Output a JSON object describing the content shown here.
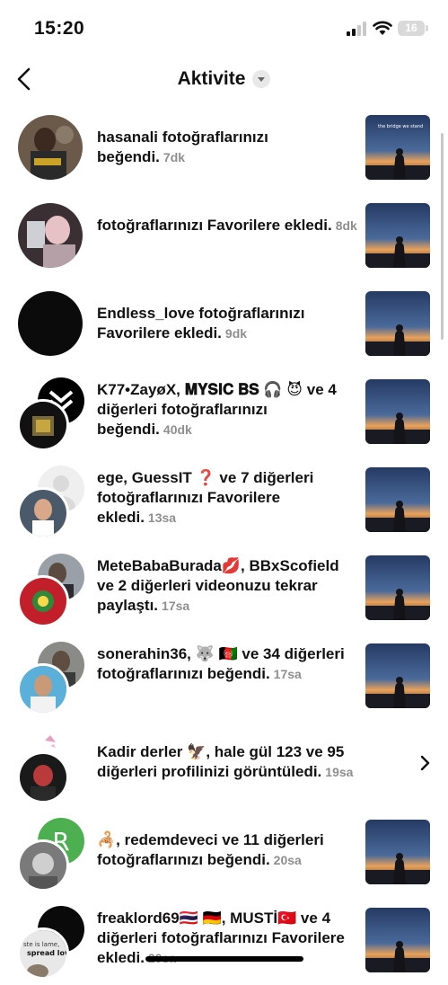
{
  "status": {
    "time": "15:20",
    "battery": "16"
  },
  "header": {
    "title": "Aktivite"
  },
  "thumb_caption": "the bridge we stand",
  "rows": [
    {
      "text": "hasanali fotoğraflarınızı beğendi.",
      "time": "7dk"
    },
    {
      "text": " fotoğraflarınızı Favorilere ekledi.",
      "time": "8dk"
    },
    {
      "text": "Endless_love fotoğraflarınızı Favorilere ekledi.",
      "time": "9dk"
    },
    {
      "text": "K77•ZayøX, 𝐌𝐘𝐒𝐈𝐂 𝐁𝐒 🎧 😈 ve 4 diğerleri fotoğraflarınızı beğendi.",
      "time": "40dk"
    },
    {
      "text": "ege, GuessIT ❓  ve 7 diğerleri fotoğraflarınızı Favorilere ekledi.",
      "time": "13sa"
    },
    {
      "text": "MeteBabaBurada💋, BBxScofield ve 2 diğerleri videonuzu tekrar paylaştı.",
      "time": "17sa"
    },
    {
      "text": "sonerahin36, 🐺 🇦🇫 ve 34 diğerleri fotoğraflarınızı beğendi.",
      "time": "17sa"
    },
    {
      "text": "Kadir derler 🦅, hale gül 123 ve 95 diğerleri profilinizi görüntüledi.",
      "time": "19sa"
    },
    {
      "text": "🦂, redemdeveci ve 11 diğerleri fotoğraflarınızı beğendi.",
      "time": "20sa"
    },
    {
      "text": "freaklord69🇹🇭 🇩🇪, MUSTİ🇹🇷 ve 4 diğerleri fotoğraflarınızı Favorilere ekledi.",
      "time": "20sa"
    }
  ],
  "avatar_overlay_text": {
    "letter": "R",
    "caption_1": "ste is lame,",
    "caption_2": "spread love"
  }
}
